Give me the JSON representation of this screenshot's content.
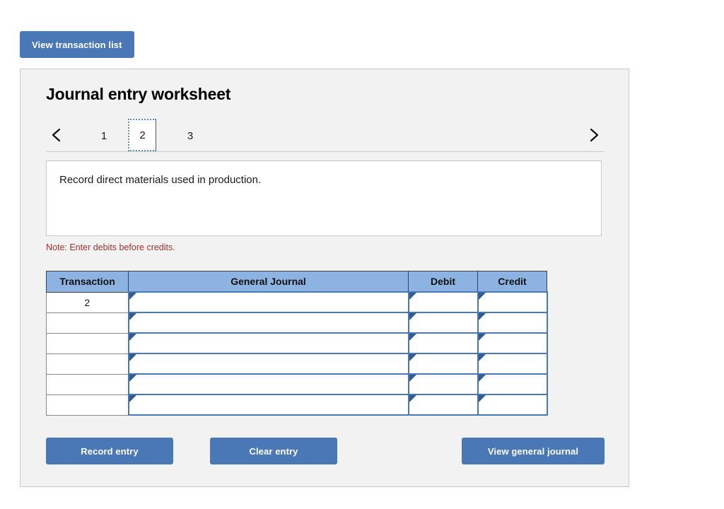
{
  "toolbar": {
    "view_transaction_list_label": "View transaction list"
  },
  "panel": {
    "title": "Journal entry worksheet"
  },
  "pagination": {
    "prev_icon": "chevron-left-icon",
    "next_icon": "chevron-right-icon",
    "pages": [
      {
        "label": "1",
        "active": false
      },
      {
        "label": "2",
        "active": true
      },
      {
        "label": "3",
        "active": false
      }
    ],
    "active_page": "2"
  },
  "prompt": {
    "text": "Record direct materials used in production."
  },
  "note": {
    "text": "Note: Enter debits before credits."
  },
  "table": {
    "headers": {
      "transaction": "Transaction",
      "general_journal": "General Journal",
      "debit": "Debit",
      "credit": "Credit"
    },
    "rows": [
      {
        "transaction": "2",
        "general_journal": "",
        "debit": "",
        "credit": ""
      },
      {
        "transaction": "",
        "general_journal": "",
        "debit": "",
        "credit": ""
      },
      {
        "transaction": "",
        "general_journal": "",
        "debit": "",
        "credit": ""
      },
      {
        "transaction": "",
        "general_journal": "",
        "debit": "",
        "credit": ""
      },
      {
        "transaction": "",
        "general_journal": "",
        "debit": "",
        "credit": ""
      },
      {
        "transaction": "",
        "general_journal": "",
        "debit": "",
        "credit": ""
      }
    ]
  },
  "actions": {
    "record_entry_label": "Record entry",
    "clear_entry_label": "Clear entry",
    "view_general_journal_label": "View general journal"
  },
  "colors": {
    "button_blue": "#4a77b5",
    "header_blue": "#8db3e2",
    "note_red": "#a3322a",
    "panel_bg": "#f2f2f2",
    "panel_border": "#c9c9c9",
    "active_tab_border": "#5b8dd0"
  }
}
